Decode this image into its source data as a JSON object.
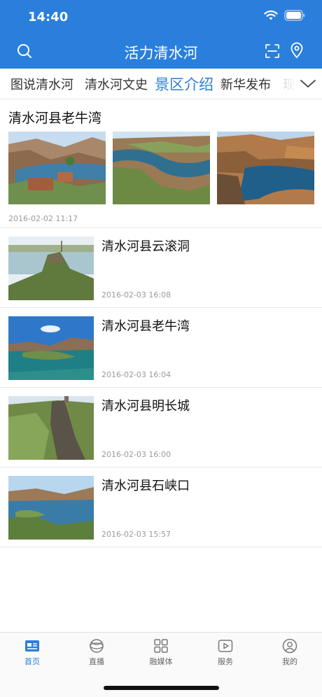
{
  "status": {
    "time": "14:40"
  },
  "header": {
    "title": "活力清水河"
  },
  "tabs": [
    {
      "label": "图说清水河"
    },
    {
      "label": "清水河文史"
    },
    {
      "label": "景区介绍"
    },
    {
      "label": "新华发布"
    },
    {
      "label": "现"
    }
  ],
  "featured": {
    "title": "清水河县老牛湾",
    "time": "2016-02-02 11:17"
  },
  "news": [
    {
      "title": "清水河县云滚洞",
      "time": "2016-02-03 16:08"
    },
    {
      "title": "清水河县老牛湾",
      "time": "2016-02-03 16:04"
    },
    {
      "title": "清水河县明长城",
      "time": "2016-02-03 16:00"
    },
    {
      "title": "清水河县石峡口",
      "time": "2016-02-03 15:57"
    }
  ],
  "tabbar": [
    {
      "label": "首页",
      "icon": "news-icon"
    },
    {
      "label": "直播",
      "icon": "live-icon"
    },
    {
      "label": "融媒体",
      "icon": "grid-icon"
    },
    {
      "label": "服务",
      "icon": "play-icon"
    },
    {
      "label": "我的",
      "icon": "user-icon"
    }
  ],
  "colors": {
    "accent": "#2a7fdc",
    "muted": "#9a9a9a"
  }
}
